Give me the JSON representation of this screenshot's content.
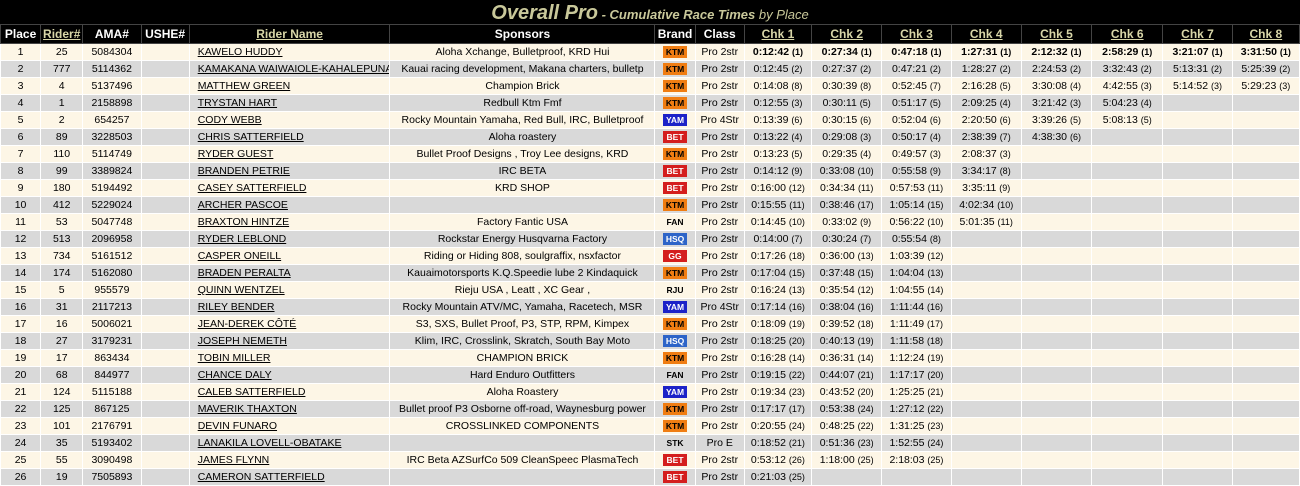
{
  "title": {
    "main": "Overall Pro",
    "sub": " - Cumulative Race Times",
    "by": " by Place"
  },
  "headers": [
    "Place",
    "Rider#",
    "AMA#",
    "USHE#",
    "Rider Name",
    "Sponsors",
    "Brand",
    "Class",
    "Chk 1",
    "Chk 2",
    "Chk 3",
    "Chk 4",
    "Chk 5",
    "Chk 6",
    "Chk 7",
    "Chk 8"
  ],
  "colors": {
    "KTM": "#f07d12",
    "YAM": "#1c22c8",
    "BET": "#d41e1e",
    "HSQ": "#2d64c8",
    "GG": "#d41e1e",
    "row_odd": "#fdf6e6",
    "row_even": "#d9d9d9"
  },
  "rows": [
    {
      "place": "1",
      "rider": "25",
      "ama": "5084304",
      "ushe": "",
      "name": "KAWELO HUDDY",
      "sponsors": "Aloha Xchange, Bulletproof, KRD Hui",
      "brand": "KTM",
      "cls": "Pro 2str",
      "chk": [
        [
          "0:12:42",
          "(1)"
        ],
        [
          "0:27:34",
          "(1)"
        ],
        [
          "0:47:18",
          "(1)"
        ],
        [
          "1:27:31",
          "(1)"
        ],
        [
          "2:12:32",
          "(1)"
        ],
        [
          "2:58:29",
          "(1)"
        ],
        [
          "3:21:07",
          "(1)"
        ],
        [
          "3:31:50",
          "(1)"
        ]
      ]
    },
    {
      "place": "2",
      "rider": "777",
      "ama": "5114362",
      "ushe": "",
      "name": "KAMAKANA WAIWAIOLE-KAHALEPUNA",
      "sponsors": "Kauai racing development, Makana charters, bulletp",
      "brand": "KTM",
      "cls": "Pro 2str",
      "chk": [
        [
          "0:12:45",
          "(2)"
        ],
        [
          "0:27:37",
          "(2)"
        ],
        [
          "0:47:21",
          "(2)"
        ],
        [
          "1:28:27",
          "(2)"
        ],
        [
          "2:24:53",
          "(2)"
        ],
        [
          "3:32:43",
          "(2)"
        ],
        [
          "5:13:31",
          "(2)"
        ],
        [
          "5:25:39",
          "(2)"
        ]
      ]
    },
    {
      "place": "3",
      "rider": "4",
      "ama": "5137496",
      "ushe": "",
      "name": "MATTHEW GREEN",
      "sponsors": "Champion Brick",
      "brand": "KTM",
      "cls": "Pro 2str",
      "chk": [
        [
          "0:14:08",
          "(8)"
        ],
        [
          "0:30:39",
          "(8)"
        ],
        [
          "0:52:45",
          "(7)"
        ],
        [
          "2:16:28",
          "(5)"
        ],
        [
          "3:30:08",
          "(4)"
        ],
        [
          "4:42:55",
          "(3)"
        ],
        [
          "5:14:52",
          "(3)"
        ],
        [
          "5:29:23",
          "(3)"
        ]
      ]
    },
    {
      "place": "4",
      "rider": "1",
      "ama": "2158898",
      "ushe": "",
      "name": "TRYSTAN HART",
      "sponsors": "Redbull Ktm Fmf",
      "brand": "KTM",
      "cls": "Pro 2str",
      "chk": [
        [
          "0:12:55",
          "(3)"
        ],
        [
          "0:30:11",
          "(5)"
        ],
        [
          "0:51:17",
          "(5)"
        ],
        [
          "2:09:25",
          "(4)"
        ],
        [
          "3:21:42",
          "(3)"
        ],
        [
          "5:04:23",
          "(4)"
        ],
        [
          "",
          ""
        ],
        [
          "",
          ""
        ]
      ]
    },
    {
      "place": "5",
      "rider": "2",
      "ama": "654257",
      "ushe": "",
      "name": "CODY WEBB",
      "sponsors": "Rocky Mountain Yamaha, Red Bull, IRC, Bulletproof",
      "brand": "YAM",
      "cls": "Pro 4Str",
      "chk": [
        [
          "0:13:39",
          "(6)"
        ],
        [
          "0:30:15",
          "(6)"
        ],
        [
          "0:52:04",
          "(6)"
        ],
        [
          "2:20:50",
          "(6)"
        ],
        [
          "3:39:26",
          "(5)"
        ],
        [
          "5:08:13",
          "(5)"
        ],
        [
          "",
          ""
        ],
        [
          "",
          ""
        ]
      ]
    },
    {
      "place": "6",
      "rider": "89",
      "ama": "3228503",
      "ushe": "",
      "name": "CHRIS SATTERFIELD",
      "sponsors": "Aloha roastery",
      "brand": "BET",
      "cls": "Pro 2str",
      "chk": [
        [
          "0:13:22",
          "(4)"
        ],
        [
          "0:29:08",
          "(3)"
        ],
        [
          "0:50:17",
          "(4)"
        ],
        [
          "2:38:39",
          "(7)"
        ],
        [
          "4:38:30",
          "(6)"
        ],
        [
          "",
          ""
        ],
        [
          "",
          ""
        ],
        [
          "",
          ""
        ]
      ]
    },
    {
      "place": "7",
      "rider": "110",
      "ama": "5114749",
      "ushe": "",
      "name": "RYDER GUEST",
      "sponsors": "Bullet Proof Designs , Troy Lee designs, KRD",
      "brand": "KTM",
      "cls": "Pro 2str",
      "chk": [
        [
          "0:13:23",
          "(5)"
        ],
        [
          "0:29:35",
          "(4)"
        ],
        [
          "0:49:57",
          "(3)"
        ],
        [
          "2:08:37",
          "(3)"
        ],
        [
          "",
          ""
        ],
        [
          "",
          ""
        ],
        [
          "",
          ""
        ],
        [
          "",
          ""
        ]
      ]
    },
    {
      "place": "8",
      "rider": "99",
      "ama": "3389824",
      "ushe": "",
      "name": "BRANDEN PETRIE",
      "sponsors": "IRC BETA",
      "brand": "BET",
      "cls": "Pro 2str",
      "chk": [
        [
          "0:14:12",
          "(9)"
        ],
        [
          "0:33:08",
          "(10)"
        ],
        [
          "0:55:58",
          "(9)"
        ],
        [
          "3:34:17",
          "(8)"
        ],
        [
          "",
          ""
        ],
        [
          "",
          ""
        ],
        [
          "",
          ""
        ],
        [
          "",
          ""
        ]
      ]
    },
    {
      "place": "9",
      "rider": "180",
      "ama": "5194492",
      "ushe": "",
      "name": "CASEY SATTERFIELD",
      "sponsors": "KRD SHOP",
      "brand": "BET",
      "cls": "Pro 2str",
      "chk": [
        [
          "0:16:00",
          "(12)"
        ],
        [
          "0:34:34",
          "(11)"
        ],
        [
          "0:57:53",
          "(11)"
        ],
        [
          "3:35:11",
          "(9)"
        ],
        [
          "",
          ""
        ],
        [
          "",
          ""
        ],
        [
          "",
          ""
        ],
        [
          "",
          ""
        ]
      ]
    },
    {
      "place": "10",
      "rider": "412",
      "ama": "5229024",
      "ushe": "",
      "name": "ARCHER PASCOE",
      "sponsors": "",
      "brand": "KTM",
      "cls": "Pro 2str",
      "chk": [
        [
          "0:15:55",
          "(11)"
        ],
        [
          "0:38:46",
          "(17)"
        ],
        [
          "1:05:14",
          "(15)"
        ],
        [
          "4:02:34",
          "(10)"
        ],
        [
          "",
          ""
        ],
        [
          "",
          ""
        ],
        [
          "",
          ""
        ],
        [
          "",
          ""
        ]
      ]
    },
    {
      "place": "11",
      "rider": "53",
      "ama": "5047748",
      "ushe": "",
      "name": "BRAXTON HINTZE",
      "sponsors": "Factory Fantic USA",
      "brand": "FAN",
      "cls": "Pro 2str",
      "chk": [
        [
          "0:14:45",
          "(10)"
        ],
        [
          "0:33:02",
          "(9)"
        ],
        [
          "0:56:22",
          "(10)"
        ],
        [
          "5:01:35",
          "(11)"
        ],
        [
          "",
          ""
        ],
        [
          "",
          ""
        ],
        [
          "",
          ""
        ],
        [
          "",
          ""
        ]
      ]
    },
    {
      "place": "12",
      "rider": "513",
      "ama": "2096958",
      "ushe": "",
      "name": "RYDER LEBLOND",
      "sponsors": "Rockstar Energy Husqvarna Factory",
      "brand": "HSQ",
      "cls": "Pro 2str",
      "chk": [
        [
          "0:14:00",
          "(7)"
        ],
        [
          "0:30:24",
          "(7)"
        ],
        [
          "0:55:54",
          "(8)"
        ],
        [
          "",
          ""
        ],
        [
          "",
          ""
        ],
        [
          "",
          ""
        ],
        [
          "",
          ""
        ],
        [
          "",
          ""
        ]
      ]
    },
    {
      "place": "13",
      "rider": "734",
      "ama": "5161512",
      "ushe": "",
      "name": "CASPER ONEILL",
      "sponsors": "Riding or Hiding 808, soulgraffix, nsxfactor",
      "brand": "GG",
      "cls": "Pro 2str",
      "chk": [
        [
          "0:17:26",
          "(18)"
        ],
        [
          "0:36:00",
          "(13)"
        ],
        [
          "1:03:39",
          "(12)"
        ],
        [
          "",
          ""
        ],
        [
          "",
          ""
        ],
        [
          "",
          ""
        ],
        [
          "",
          ""
        ],
        [
          "",
          ""
        ]
      ]
    },
    {
      "place": "14",
      "rider": "174",
      "ama": "5162080",
      "ushe": "",
      "name": "BRADEN PERALTA",
      "sponsors": "Kauaimotorsports K.Q.Speedie lube 2 Kindaquick",
      "brand": "KTM",
      "cls": "Pro 2str",
      "chk": [
        [
          "0:17:04",
          "(15)"
        ],
        [
          "0:37:48",
          "(15)"
        ],
        [
          "1:04:04",
          "(13)"
        ],
        [
          "",
          ""
        ],
        [
          "",
          ""
        ],
        [
          "",
          ""
        ],
        [
          "",
          ""
        ],
        [
          "",
          ""
        ]
      ]
    },
    {
      "place": "15",
      "rider": "5",
      "ama": "955579",
      "ushe": "",
      "name": "QUINN WENTZEL",
      "sponsors": "Rieju USA , Leatt , XC Gear ,",
      "brand": "RJU",
      "cls": "Pro 2str",
      "chk": [
        [
          "0:16:24",
          "(13)"
        ],
        [
          "0:35:54",
          "(12)"
        ],
        [
          "1:04:55",
          "(14)"
        ],
        [
          "",
          ""
        ],
        [
          "",
          ""
        ],
        [
          "",
          ""
        ],
        [
          "",
          ""
        ],
        [
          "",
          ""
        ]
      ]
    },
    {
      "place": "16",
      "rider": "31",
      "ama": "2117213",
      "ushe": "",
      "name": "RILEY BENDER",
      "sponsors": "Rocky Mountain ATV/MC, Yamaha, Racetech, MSR",
      "brand": "YAM",
      "cls": "Pro 4Str",
      "chk": [
        [
          "0:17:14",
          "(16)"
        ],
        [
          "0:38:04",
          "(16)"
        ],
        [
          "1:11:44",
          "(16)"
        ],
        [
          "",
          ""
        ],
        [
          "",
          ""
        ],
        [
          "",
          ""
        ],
        [
          "",
          ""
        ],
        [
          "",
          ""
        ]
      ]
    },
    {
      "place": "17",
      "rider": "16",
      "ama": "5006021",
      "ushe": "",
      "name": "JEAN-DEREK CÔTÉ",
      "sponsors": "S3, SXS, Bullet Proof, P3, STP, RPM, Kimpex",
      "brand": "KTM",
      "cls": "Pro 2str",
      "chk": [
        [
          "0:18:09",
          "(19)"
        ],
        [
          "0:39:52",
          "(18)"
        ],
        [
          "1:11:49",
          "(17)"
        ],
        [
          "",
          ""
        ],
        [
          "",
          ""
        ],
        [
          "",
          ""
        ],
        [
          "",
          ""
        ],
        [
          "",
          ""
        ]
      ]
    },
    {
      "place": "18",
      "rider": "27",
      "ama": "3179231",
      "ushe": "",
      "name": "JOSEPH NEMETH",
      "sponsors": "Klim, IRC, Crosslink, Skratch, South Bay Moto",
      "brand": "HSQ",
      "cls": "Pro 2str",
      "chk": [
        [
          "0:18:25",
          "(20)"
        ],
        [
          "0:40:13",
          "(19)"
        ],
        [
          "1:11:58",
          "(18)"
        ],
        [
          "",
          ""
        ],
        [
          "",
          ""
        ],
        [
          "",
          ""
        ],
        [
          "",
          ""
        ],
        [
          "",
          ""
        ]
      ]
    },
    {
      "place": "19",
      "rider": "17",
      "ama": "863434",
      "ushe": "",
      "name": "TOBIN MILLER",
      "sponsors": "CHAMPION BRICK",
      "brand": "KTM",
      "cls": "Pro 2str",
      "chk": [
        [
          "0:16:28",
          "(14)"
        ],
        [
          "0:36:31",
          "(14)"
        ],
        [
          "1:12:24",
          "(19)"
        ],
        [
          "",
          ""
        ],
        [
          "",
          ""
        ],
        [
          "",
          ""
        ],
        [
          "",
          ""
        ],
        [
          "",
          ""
        ]
      ]
    },
    {
      "place": "20",
      "rider": "68",
      "ama": "844977",
      "ushe": "",
      "name": "CHANCE DALY",
      "sponsors": "Hard Enduro Outfitters",
      "brand": "FAN",
      "cls": "Pro 2str",
      "chk": [
        [
          "0:19:15",
          "(22)"
        ],
        [
          "0:44:07",
          "(21)"
        ],
        [
          "1:17:17",
          "(20)"
        ],
        [
          "",
          ""
        ],
        [
          "",
          ""
        ],
        [
          "",
          ""
        ],
        [
          "",
          ""
        ],
        [
          "",
          ""
        ]
      ]
    },
    {
      "place": "21",
      "rider": "124",
      "ama": "5115188",
      "ushe": "",
      "name": "CALEB SATTERFIELD",
      "sponsors": "Aloha Roastery",
      "brand": "YAM",
      "cls": "Pro 2str",
      "chk": [
        [
          "0:19:34",
          "(23)"
        ],
        [
          "0:43:52",
          "(20)"
        ],
        [
          "1:25:25",
          "(21)"
        ],
        [
          "",
          ""
        ],
        [
          "",
          ""
        ],
        [
          "",
          ""
        ],
        [
          "",
          ""
        ],
        [
          "",
          ""
        ]
      ]
    },
    {
      "place": "22",
      "rider": "125",
      "ama": "867125",
      "ushe": "",
      "name": "MAVERIK THAXTON",
      "sponsors": "Bullet proof P3 Osborne off-road, Waynesburg power",
      "brand": "KTM",
      "cls": "Pro 2str",
      "chk": [
        [
          "0:17:17",
          "(17)"
        ],
        [
          "0:53:38",
          "(24)"
        ],
        [
          "1:27:12",
          "(22)"
        ],
        [
          "",
          ""
        ],
        [
          "",
          ""
        ],
        [
          "",
          ""
        ],
        [
          "",
          ""
        ],
        [
          "",
          ""
        ]
      ]
    },
    {
      "place": "23",
      "rider": "101",
      "ama": "2176791",
      "ushe": "",
      "name": "DEVIN FUNARO",
      "sponsors": "CROSSLINKED COMPONENTS",
      "brand": "KTM",
      "cls": "Pro 2str",
      "chk": [
        [
          "0:20:55",
          "(24)"
        ],
        [
          "0:48:25",
          "(22)"
        ],
        [
          "1:31:25",
          "(23)"
        ],
        [
          "",
          ""
        ],
        [
          "",
          ""
        ],
        [
          "",
          ""
        ],
        [
          "",
          ""
        ],
        [
          "",
          ""
        ]
      ]
    },
    {
      "place": "24",
      "rider": "35",
      "ama": "5193402",
      "ushe": "",
      "name": "LANAKILA LOVELL-OBATAKE",
      "sponsors": "",
      "brand": "STK",
      "cls": "Pro E",
      "chk": [
        [
          "0:18:52",
          "(21)"
        ],
        [
          "0:51:36",
          "(23)"
        ],
        [
          "1:52:55",
          "(24)"
        ],
        [
          "",
          ""
        ],
        [
          "",
          ""
        ],
        [
          "",
          ""
        ],
        [
          "",
          ""
        ],
        [
          "",
          ""
        ]
      ]
    },
    {
      "place": "25",
      "rider": "55",
      "ama": "3090498",
      "ushe": "",
      "name": "JAMES FLYNN",
      "sponsors": "IRC Beta AZSurfCo 509 CleanSpeec PlasmaTech",
      "brand": "BET",
      "cls": "Pro 2str",
      "chk": [
        [
          "0:53:12",
          "(26)"
        ],
        [
          "1:18:00",
          "(25)"
        ],
        [
          "2:18:03",
          "(25)"
        ],
        [
          "",
          ""
        ],
        [
          "",
          ""
        ],
        [
          "",
          ""
        ],
        [
          "",
          ""
        ],
        [
          "",
          ""
        ]
      ]
    },
    {
      "place": "26",
      "rider": "19",
      "ama": "7505893",
      "ushe": "",
      "name": "CAMERON SATTERFIELD",
      "sponsors": "",
      "brand": "BET",
      "cls": "Pro 2str",
      "chk": [
        [
          "0:21:03",
          "(25)"
        ],
        [
          "",
          ""
        ],
        [
          "",
          ""
        ],
        [
          "",
          ""
        ],
        [
          "",
          ""
        ],
        [
          "",
          ""
        ],
        [
          "",
          ""
        ],
        [
          "",
          ""
        ]
      ]
    }
  ]
}
